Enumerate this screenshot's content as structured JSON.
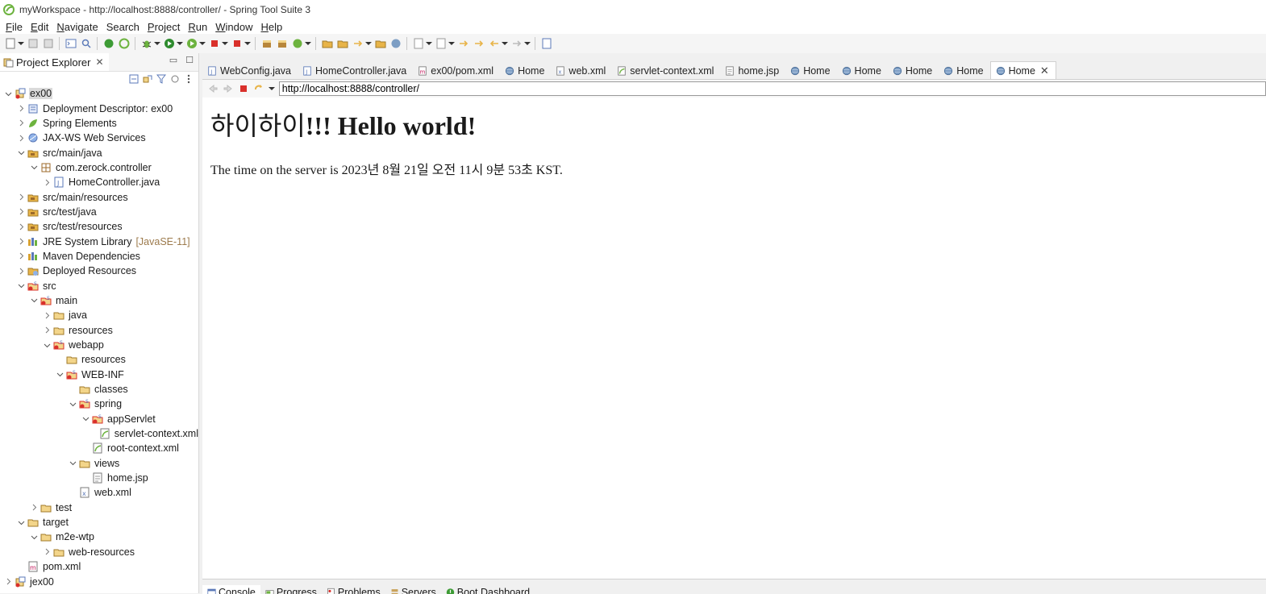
{
  "window": {
    "title": "myWorkspace - http://localhost:8888/controller/ - Spring Tool Suite 3"
  },
  "menu": [
    {
      "u": "F",
      "rest": "ile"
    },
    {
      "u": "E",
      "rest": "dit"
    },
    {
      "u": "N",
      "rest": "avigate"
    },
    {
      "u": "",
      "rest": "Search"
    },
    {
      "u": "P",
      "rest": "roject"
    },
    {
      "u": "R",
      "rest": "un"
    },
    {
      "u": "W",
      "rest": "indow"
    },
    {
      "u": "H",
      "rest": "elp"
    }
  ],
  "explorer": {
    "title": "Project Explorer",
    "items": [
      {
        "depth": 0,
        "chev": "down",
        "icon": "project-icon",
        "label": "ex00",
        "selected": true
      },
      {
        "depth": 1,
        "chev": "right",
        "icon": "deployment-descriptor-icon",
        "label": "Deployment Descriptor: ex00"
      },
      {
        "depth": 1,
        "chev": "right",
        "icon": "spring-leaf-icon",
        "label": "Spring Elements"
      },
      {
        "depth": 1,
        "chev": "right",
        "icon": "web-services-icon",
        "label": "JAX-WS Web Services"
      },
      {
        "depth": 1,
        "chev": "down",
        "icon": "source-folder-icon",
        "label": "src/main/java"
      },
      {
        "depth": 2,
        "chev": "down",
        "icon": "package-icon",
        "label": "com.zerock.controller"
      },
      {
        "depth": 3,
        "chev": "right",
        "icon": "java-file-icon",
        "label": "HomeController.java"
      },
      {
        "depth": 1,
        "chev": "right",
        "icon": "source-folder-icon",
        "label": "src/main/resources"
      },
      {
        "depth": 1,
        "chev": "right",
        "icon": "source-folder-icon",
        "label": "src/test/java"
      },
      {
        "depth": 1,
        "chev": "right",
        "icon": "source-folder-icon",
        "label": "src/test/resources"
      },
      {
        "depth": 1,
        "chev": "right",
        "icon": "library-icon",
        "label": "JRE System Library",
        "deco": "[JavaSE-11]"
      },
      {
        "depth": 1,
        "chev": "right",
        "icon": "library-icon",
        "label": "Maven Dependencies"
      },
      {
        "depth": 1,
        "chev": "right",
        "icon": "deployed-resources-icon",
        "label": "Deployed Resources"
      },
      {
        "depth": 1,
        "chev": "down",
        "icon": "spring-folder-icon",
        "label": "src"
      },
      {
        "depth": 2,
        "chev": "down",
        "icon": "spring-folder-icon",
        "label": "main"
      },
      {
        "depth": 3,
        "chev": "right",
        "icon": "folder-icon",
        "label": "java"
      },
      {
        "depth": 3,
        "chev": "right",
        "icon": "folder-icon",
        "label": "resources"
      },
      {
        "depth": 3,
        "chev": "down",
        "icon": "spring-folder-icon",
        "label": "webapp"
      },
      {
        "depth": 4,
        "chev": "none",
        "icon": "folder-icon",
        "label": "resources"
      },
      {
        "depth": 4,
        "chev": "down",
        "icon": "spring-folder-icon",
        "label": "WEB-INF"
      },
      {
        "depth": 5,
        "chev": "none",
        "icon": "folder-icon",
        "label": "classes"
      },
      {
        "depth": 5,
        "chev": "down",
        "icon": "spring-folder-icon",
        "label": "spring"
      },
      {
        "depth": 6,
        "chev": "down",
        "icon": "spring-folder-icon",
        "label": "appServlet"
      },
      {
        "depth": 7,
        "chev": "none",
        "icon": "spring-xml-icon",
        "label": "servlet-context.xml"
      },
      {
        "depth": 6,
        "chev": "none",
        "icon": "spring-xml-icon",
        "label": "root-context.xml"
      },
      {
        "depth": 5,
        "chev": "down",
        "icon": "folder-icon",
        "label": "views"
      },
      {
        "depth": 6,
        "chev": "none",
        "icon": "jsp-file-icon",
        "label": "home.jsp"
      },
      {
        "depth": 5,
        "chev": "none",
        "icon": "xml-file-icon",
        "label": "web.xml"
      },
      {
        "depth": 2,
        "chev": "right",
        "icon": "folder-icon",
        "label": "test"
      },
      {
        "depth": 1,
        "chev": "down",
        "icon": "folder-icon",
        "label": "target"
      },
      {
        "depth": 2,
        "chev": "down",
        "icon": "folder-icon",
        "label": "m2e-wtp"
      },
      {
        "depth": 3,
        "chev": "right",
        "icon": "folder-icon",
        "label": "web-resources"
      },
      {
        "depth": 1,
        "chev": "none",
        "icon": "maven-pom-icon",
        "label": "pom.xml"
      },
      {
        "depth": 0,
        "chev": "right",
        "icon": "project-icon",
        "label": "jex00"
      }
    ]
  },
  "editor": {
    "tabs": [
      {
        "icon": "java-file-icon",
        "label": "WebConfig.java"
      },
      {
        "icon": "java-file-icon",
        "label": "HomeController.java"
      },
      {
        "icon": "maven-pom-icon",
        "label": "ex00/pom.xml"
      },
      {
        "icon": "globe-icon",
        "label": "Home"
      },
      {
        "icon": "xml-file-icon",
        "label": "web.xml"
      },
      {
        "icon": "spring-xml-icon",
        "label": "servlet-context.xml"
      },
      {
        "icon": "jsp-file-icon",
        "label": "home.jsp"
      },
      {
        "icon": "globe-icon",
        "label": "Home"
      },
      {
        "icon": "globe-icon",
        "label": "Home"
      },
      {
        "icon": "globe-icon",
        "label": "Home"
      },
      {
        "icon": "globe-icon",
        "label": "Home"
      },
      {
        "icon": "globe-icon",
        "label": "Home",
        "active": true
      }
    ],
    "url": "http://localhost:8888/controller/",
    "page": {
      "heading_kr": "하이하이",
      "heading_en": "!!! Hello world!",
      "text": "The time on the server is 2023년 8월 21일 오전 11시 9분 53초 KST."
    }
  },
  "bottom": {
    "tabs": [
      {
        "icon": "console-icon",
        "label": "Console",
        "active": true
      },
      {
        "icon": "progress-icon",
        "label": "Progress"
      },
      {
        "icon": "problems-icon",
        "label": "Problems"
      },
      {
        "icon": "servers-icon",
        "label": "Servers"
      },
      {
        "icon": "boot-dashboard-icon",
        "label": "Boot Dashboard"
      }
    ]
  },
  "colors": {
    "spring_green": "#6db33f",
    "folder_yellow": "#e8b448",
    "java_blue": "#5b79b8",
    "error_red": "#d9302b"
  }
}
